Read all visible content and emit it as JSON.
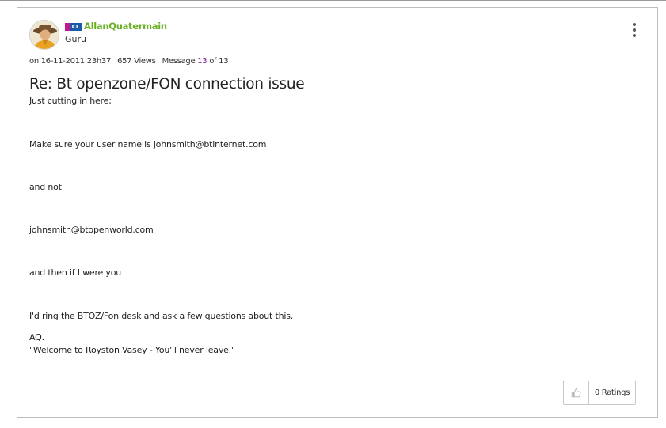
{
  "post": {
    "author": {
      "name": "AllanQuatermain",
      "rank": "Guru",
      "badge_text": "CL",
      "avatar_icon": "user-avatar-icon"
    },
    "meta": {
      "date_prefix": "on",
      "date": "16-11-2011",
      "time": "23h37",
      "views": "657 Views",
      "message_label": "Message",
      "message_number": "13",
      "message_of": "of 13"
    },
    "subject": "Re: Bt openzone/FON connection issue",
    "body": [
      "Just cutting in here;",
      "Make sure your user name is johnsmith@btinternet.com",
      "and not",
      "johnsmith@btopenworld.com",
      "and then if I were you",
      "I'd ring the BTOZ/Fon desk and ask a few questions about this.",
      "AQ.",
      "\"Welcome to Royston Vasey - You'll never leave.\""
    ],
    "rating": {
      "label": "0 Ratings",
      "icon": "thumbs-up-icon"
    },
    "menu_icon": "more-options-icon"
  },
  "colors": {
    "username": "#6ab023",
    "message_number": "#7a1b8e",
    "badge_blue": "#1a5aa6",
    "badge_pink": "#c1188b",
    "border": "#bdbdbd"
  }
}
